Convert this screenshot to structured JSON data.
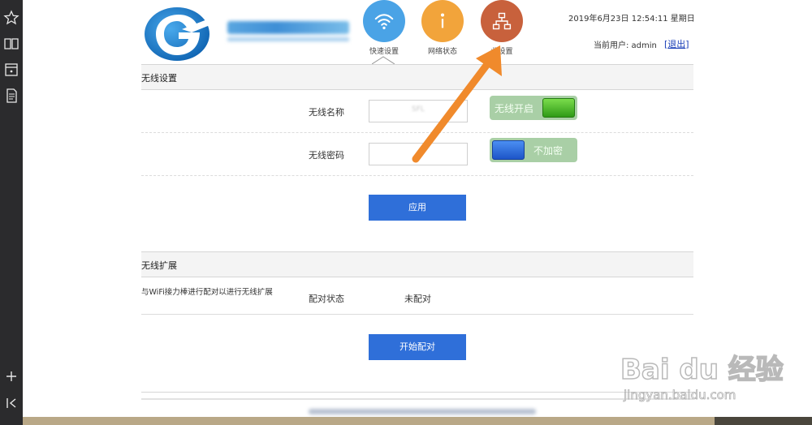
{
  "header": {
    "logo_text": "广西广电网络",
    "datetime": "2019年6月23日 12:54:11 星期日",
    "user_label": "当前用户: admin",
    "logout_left": "[",
    "logout_label": "退出",
    "logout_right": "]"
  },
  "nav": {
    "items": [
      {
        "label": "快速设置",
        "icon": "wifi-icon",
        "color": "#4aa3e6"
      },
      {
        "label": "网络状态",
        "icon": "info-icon",
        "color": "#f2a43b"
      },
      {
        "label": "业设置",
        "icon": "network-icon",
        "color": "#c8613c"
      }
    ],
    "active": "快速设置"
  },
  "wireless": {
    "section_title": "无线设置",
    "name_label": "无线名称",
    "name_value": "SFL",
    "switch_label": "无线开启",
    "password_label": "无线密码",
    "password_value": "",
    "encrypt_label": "不加密",
    "apply_button": "应用"
  },
  "extension": {
    "section_title": "无线扩展",
    "description": "与WiFi接力棒进行配对以进行无线扩展",
    "pair_status_label": "配对状态",
    "pair_status_value": "未配对",
    "pair_button": "开始配对"
  },
  "watermark": {
    "brand": "Bai du 经验",
    "url": "jingyan.baidu.com"
  },
  "colors": {
    "accent_blue": "#2f6fd9",
    "switch_green": "#a9cfa6",
    "arrow_orange": "#f08a2c"
  }
}
